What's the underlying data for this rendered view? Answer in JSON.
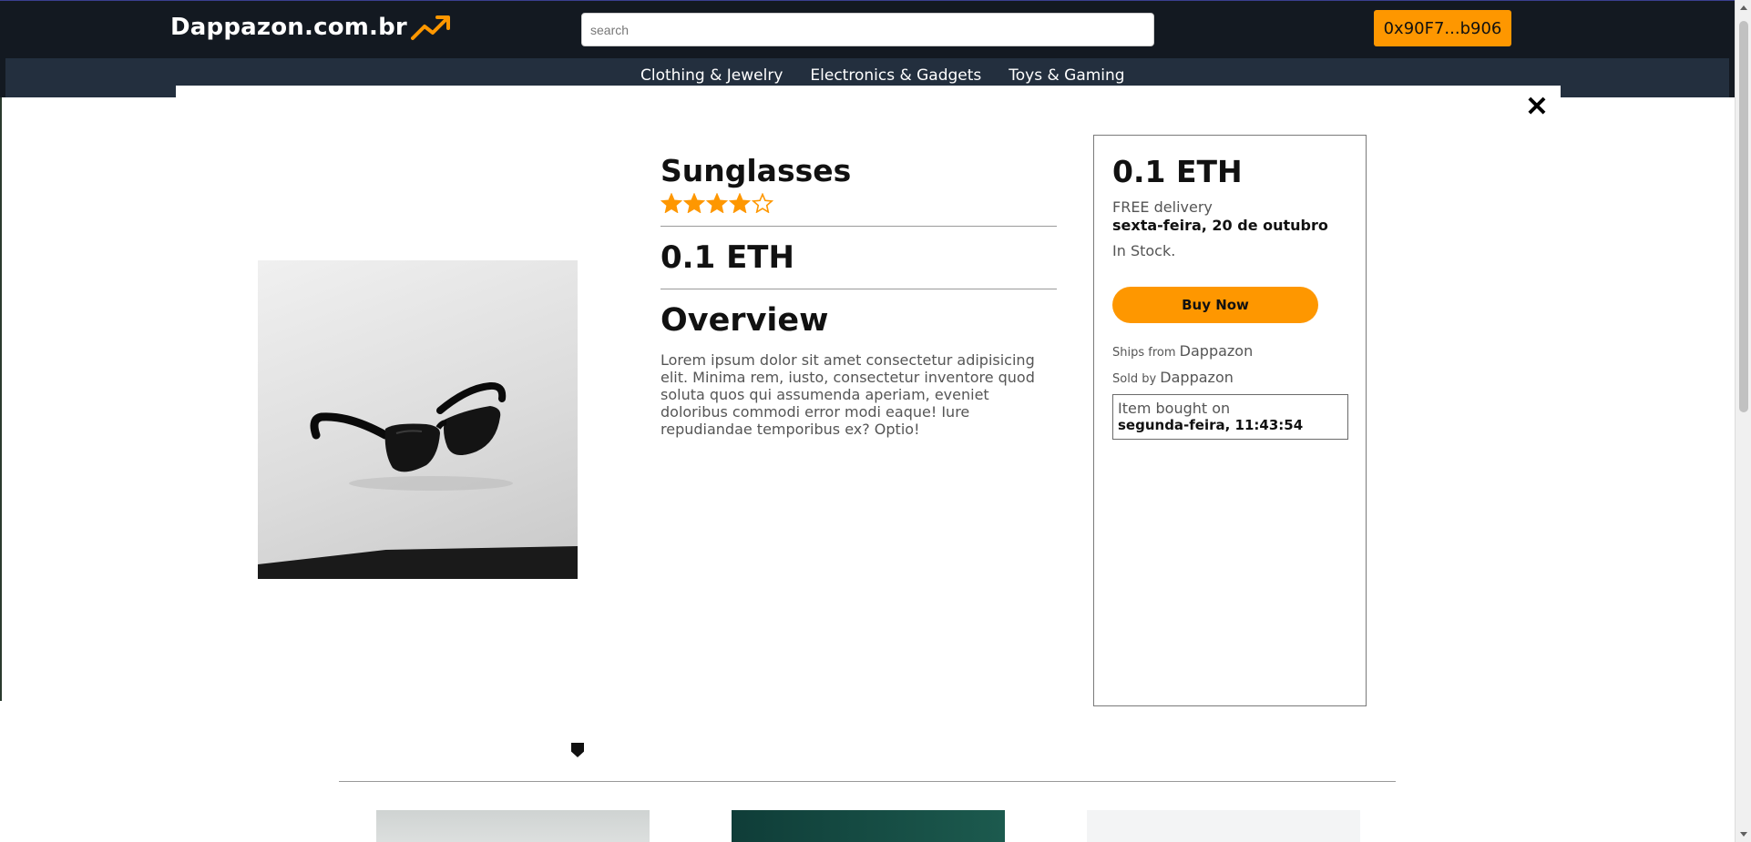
{
  "navbar": {
    "brand": "Dappazon.com.br",
    "brand_icon": "trending-up-icon",
    "search_placeholder": "search",
    "account": "0x90F7...b906",
    "categories": [
      "Clothing & Jewelry",
      "Electronics & Gadgets",
      "Toys & Gaming"
    ]
  },
  "colors": {
    "nav_bg": "#131921",
    "catbar_bg": "#232f3e",
    "accent": "#fe9700"
  },
  "product": {
    "name": "Sunglasses",
    "rating": 4,
    "rating_max": 5,
    "price": "0.1 ETH",
    "overview_title": "Overview",
    "description": "Lorem ipsum dolor sit amet consectetur adipisicing elit. Minima rem, iusto, consectetur inventore quod soluta quos qui assumenda aperiam, eveniet doloribus commodi error modi eaque! Iure repudiandae temporibus ex? Optio!",
    "image_icon": "sunglasses-image"
  },
  "buybox": {
    "price": "0.1 ETH",
    "delivery": "FREE delivery",
    "delivery_date": "sexta-feira, 20 de outubro",
    "stock": "In Stock.",
    "buy_label": "Buy Now",
    "ships_from_label": "Ships from",
    "ships_from": "Dappazon",
    "sold_by_label": "Sold by",
    "sold_by": "Dappazon",
    "bought_label": "Item bought on",
    "bought_date": "segunda-feira, 11:43:54"
  },
  "modal": {
    "close_icon": "close-icon",
    "close_symbol": "✕"
  }
}
